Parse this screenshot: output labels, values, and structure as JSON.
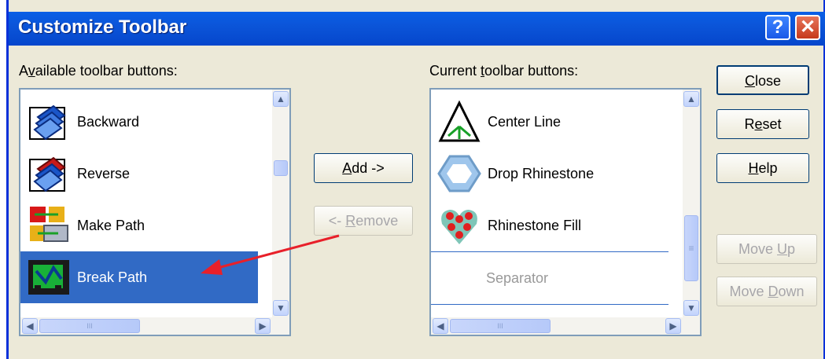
{
  "window": {
    "title": "Customize Toolbar",
    "help_glyph": "?",
    "close_glyph": "✕"
  },
  "available": {
    "label_pre": "A",
    "label_u": "v",
    "label_post": "ailable toolbar buttons:",
    "items": [
      {
        "label": "Backward",
        "icon": "backward-icon"
      },
      {
        "label": "Reverse",
        "icon": "reverse-icon"
      },
      {
        "label": "Make Path",
        "icon": "make-path-icon"
      },
      {
        "label": "Break Path",
        "icon": "break-path-icon",
        "selected": true
      }
    ]
  },
  "current": {
    "label_pre": "Current ",
    "label_u": "t",
    "label_post": "oolbar buttons:",
    "items": [
      {
        "label": "Center Line",
        "icon": "center-line-icon"
      },
      {
        "label": "Drop Rhinestone",
        "icon": "drop-rhinestone-icon"
      },
      {
        "label": "Rhinestone Fill",
        "icon": "rhinestone-fill-icon"
      },
      {
        "label": "Separator",
        "icon": ""
      }
    ]
  },
  "buttons": {
    "add": {
      "u": "A",
      "rest": "dd ->"
    },
    "remove": {
      "pre": "<- ",
      "u": "R",
      "rest": "emove"
    },
    "close": {
      "u": "C",
      "rest": "lose"
    },
    "reset": {
      "pre": "R",
      "u": "e",
      "rest": "set"
    },
    "help": {
      "u": "H",
      "rest": "elp"
    },
    "move_up": {
      "pre": "Move ",
      "u": "U",
      "rest": "p"
    },
    "move_down": {
      "pre": "Move ",
      "u": "D",
      "rest": "own"
    }
  },
  "scroll_glyphs": {
    "up": "▲",
    "down": "▼",
    "left": "◀",
    "right": "▶",
    "grip": "≡",
    "grip_h": "III"
  }
}
